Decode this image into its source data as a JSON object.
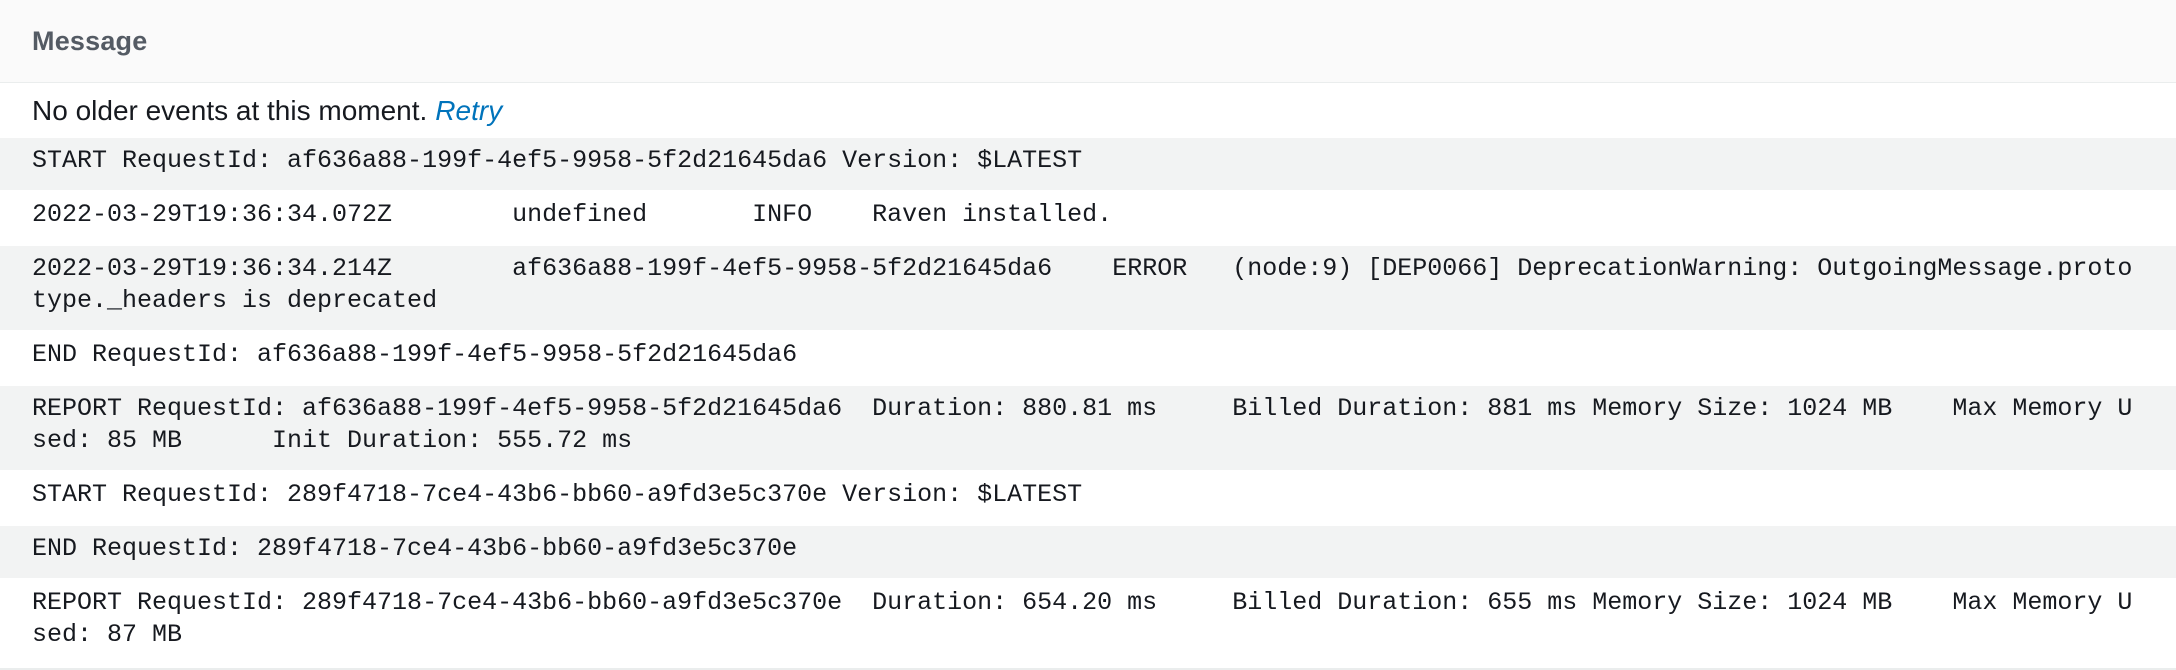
{
  "header": {
    "title": "Message"
  },
  "notice": {
    "text": "No older events at this moment.",
    "retry_label": "Retry"
  },
  "log_rows": [
    "START RequestId: af636a88-199f-4ef5-9958-5f2d21645da6 Version: $LATEST",
    "2022-03-29T19:36:34.072Z\tundefined\tINFO\tRaven installed.",
    "2022-03-29T19:36:34.214Z\taf636a88-199f-4ef5-9958-5f2d21645da6\tERROR\t(node:9) [DEP0066] DeprecationWarning: OutgoingMessage.prototype._headers is deprecated",
    "END RequestId: af636a88-199f-4ef5-9958-5f2d21645da6",
    "REPORT RequestId: af636a88-199f-4ef5-9958-5f2d21645da6\tDuration: 880.81 ms\tBilled Duration: 881 ms\tMemory Size: 1024 MB\tMax Memory Used: 85 MB\tInit Duration: 555.72 ms",
    "START RequestId: 289f4718-7ce4-43b6-bb60-a9fd3e5c370e Version: $LATEST",
    "END RequestId: 289f4718-7ce4-43b6-bb60-a9fd3e5c370e",
    "REPORT RequestId: 289f4718-7ce4-43b6-bb60-a9fd3e5c370e\tDuration: 654.20 ms\tBilled Duration: 655 ms\tMemory Size: 1024 MB\tMax Memory Used: 87 MB"
  ]
}
